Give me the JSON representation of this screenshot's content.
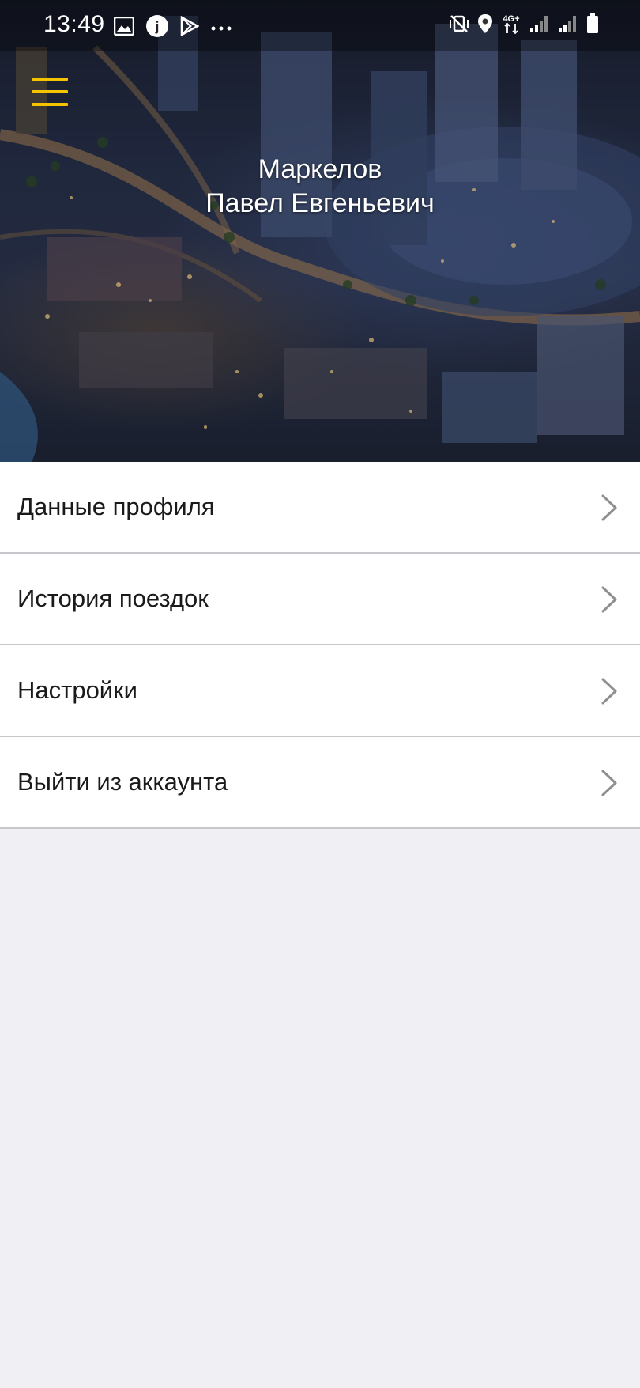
{
  "status_bar": {
    "time": "13:49",
    "left_icons": [
      "image-icon",
      "app-j-icon",
      "play-store-icon",
      "more-dots-icon"
    ],
    "right_icons": [
      "mute-vibrate-icon",
      "location-icon",
      "network-4g-icon",
      "signal-icon",
      "signal-icon",
      "battery-icon"
    ],
    "network_label": "4G+"
  },
  "header": {
    "menu_icon": "hamburger-menu-icon",
    "menu_color": "#f5c400",
    "last_name": "Маркелов",
    "first_middle_name": "Павел Евгеньевич"
  },
  "menu": {
    "items": [
      {
        "label": "Данные профиля",
        "icon": "chevron-right-icon"
      },
      {
        "label": "История поездок",
        "icon": "chevron-right-icon"
      },
      {
        "label": "Настройки",
        "icon": "chevron-right-icon"
      },
      {
        "label": "Выйти из аккаунта",
        "icon": "chevron-right-icon"
      }
    ]
  },
  "colors": {
    "background": "#efeff4",
    "list_background": "#ffffff",
    "divider": "#c8c8cc",
    "accent": "#f5c400"
  }
}
